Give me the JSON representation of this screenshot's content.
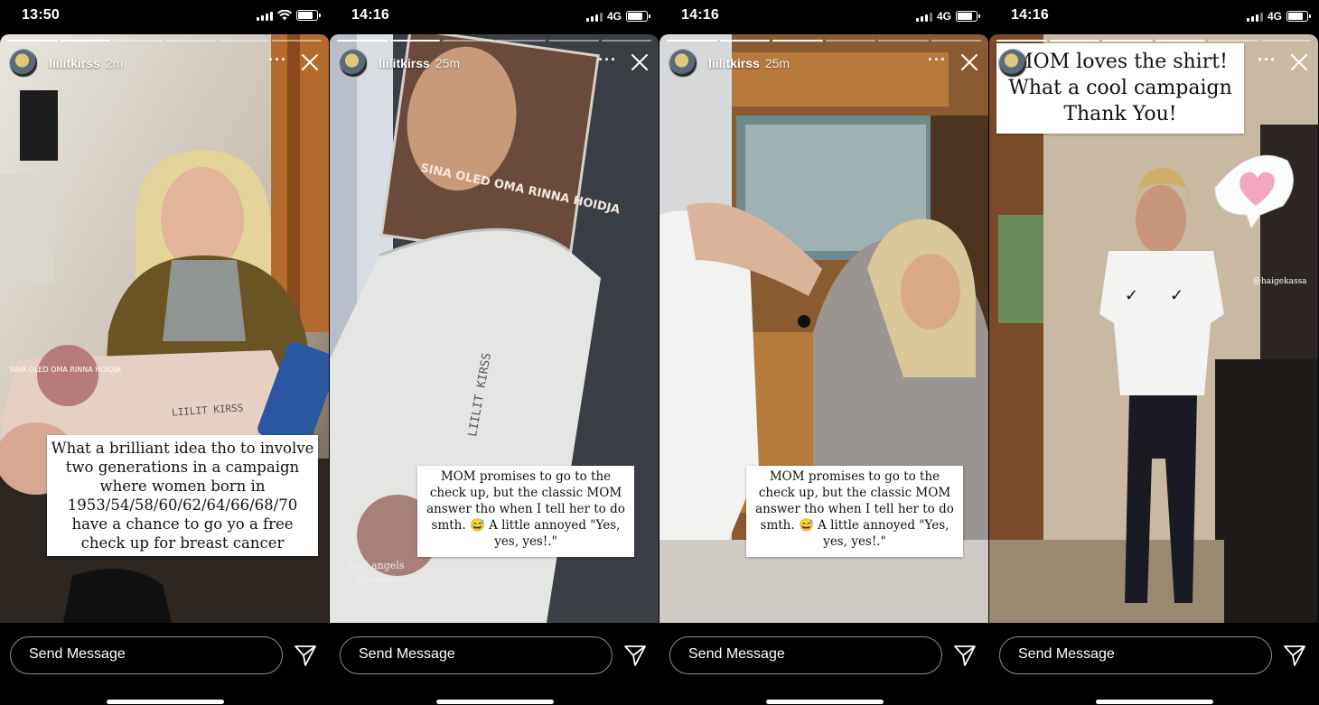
{
  "panels": [
    {
      "time": "13:50",
      "network": "",
      "username": "liilitkirss",
      "ago": "2m",
      "progress_done": 2,
      "caption": "What a brilliant idea tho to involve two generations in a campaign where women born in 1953/54/58/60/62/64/66/68/70 have a chance to go yo a free check up for breast cancer",
      "send_placeholder": "Send Message"
    },
    {
      "time": "14:16",
      "network": "4G",
      "username": "liilitkirss",
      "ago": "25m",
      "progress_done": 2,
      "caption": "MOM promises to go to the check up, but the classic MOM answer tho when I tell her to do smth. 😅 A little annoyed \"Yes, yes, yes!.\"",
      "send_placeholder": "Send Message"
    },
    {
      "time": "14:16",
      "network": "4G",
      "username": "liilitkirss",
      "ago": "25m",
      "progress_done": 3,
      "caption": "MOM promises to go to the check up, but the classic MOM answer tho when I tell her to do smth. 😅 A little annoyed \"Yes, yes, yes!.\"",
      "send_placeholder": "Send Message"
    },
    {
      "time": "14:16",
      "network": "4G",
      "username": "",
      "ago": "",
      "progress_done": 4,
      "caption": "MOM loves the shirt! What a cool campaign Thank You!",
      "send_placeholder": "Send Message"
    }
  ],
  "scene_text": {
    "box1": "SINA OLED OMA RINNA HOIDJA",
    "name1": "LIILIT KIRSS",
    "box2_title": "SINA OLED OMA RINNA HOIDJA",
    "name2": "LIILIT KIRSS",
    "tag2a": "@ad.angels",
    "tag2b": "@haigekassa",
    "tag4": "@haigekassa"
  },
  "icons": {
    "more": "more-dots-icon",
    "close": "close-icon",
    "send": "send-arrow-icon",
    "heart": "heart-sticker-icon"
  },
  "colors": {
    "background": "#000000",
    "caption_bg": "#ffffff",
    "caption_text": "#111111",
    "heart": "#f2a6bf"
  }
}
